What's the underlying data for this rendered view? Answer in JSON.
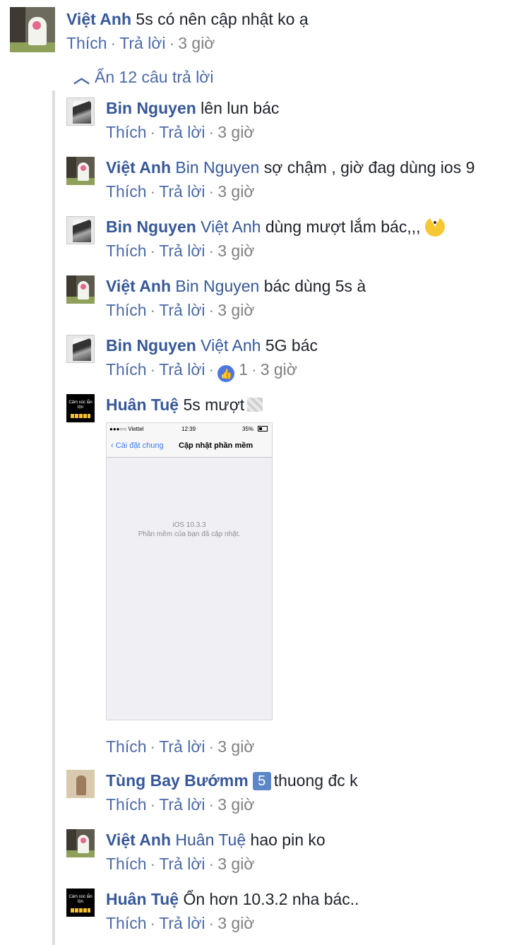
{
  "meta": {
    "like": "Thích",
    "reply": "Trả lời",
    "time": "3 giờ"
  },
  "top_comment": {
    "author": "Việt Anh",
    "text": "5s có nên cập nhật ko ạ"
  },
  "toggle": {
    "label": "Ẩn 12 câu trả lời"
  },
  "replies": [
    {
      "author": "Bin Nguyen",
      "tag": "",
      "text": "lên lun bác"
    },
    {
      "author": "Việt Anh",
      "tag": "Bin Nguyen",
      "text": "sợ chậm , giờ đag dùng ios 9"
    },
    {
      "author": "Bin Nguyen",
      "tag": "Việt Anh",
      "text": "dùng mượt lắm bác,,,"
    },
    {
      "author": "Việt Anh",
      "tag": "Bin Nguyen",
      "text": "bác dùng 5s à"
    },
    {
      "author": "Bin Nguyen",
      "tag": "Việt Anh",
      "text": "5G bác",
      "reactions": "1"
    },
    {
      "author": "Huân Tuệ",
      "tag": "",
      "text": "5s mượt"
    },
    {
      "author": "Tùng Bay Bướmm",
      "tag": "",
      "badge": "5",
      "text": "thuong đc k"
    },
    {
      "author": "Việt Anh",
      "tag": "Huân Tuệ",
      "text": "hao pin ko"
    },
    {
      "author": "Huân Tuệ",
      "tag": "",
      "text": "Ổn hơn 10.3.2 nha bác.."
    }
  ],
  "avatar_huan_text": "Cảm xúc lẫn lộn",
  "screenshot": {
    "carrier": "●●●○○ Viettel",
    "clock": "12:39",
    "battery": "35%",
    "back": "Cài đặt chung",
    "title": "Cập nhật phần mềm",
    "version": "iOS 10.3.3",
    "status_msg": "Phần mềm của bạn đã cập nhật."
  }
}
